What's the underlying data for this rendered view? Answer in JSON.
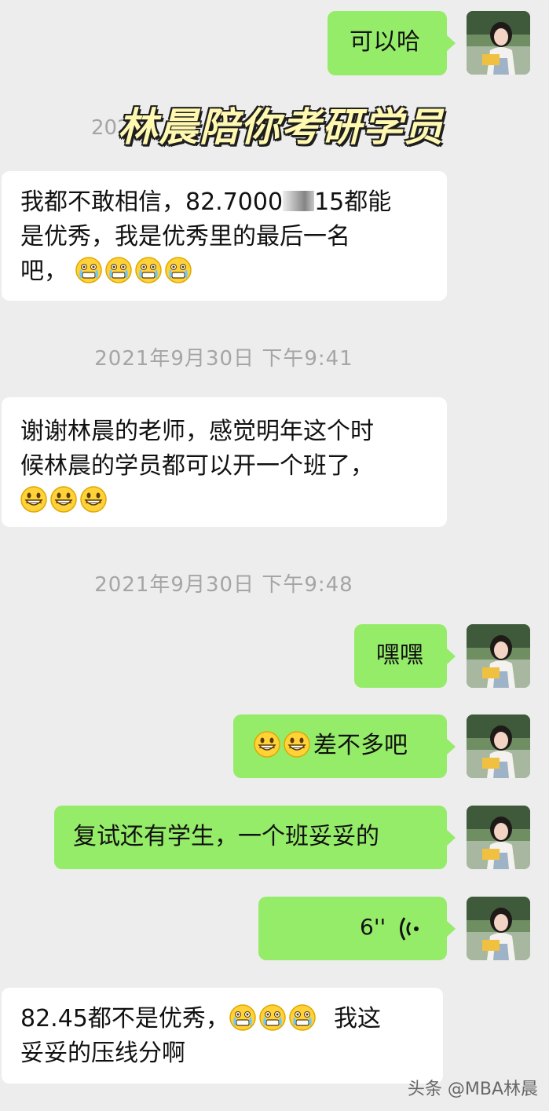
{
  "watermark": {
    "text": "林晨陪你考研学员"
  },
  "partial_timestamp": "2021",
  "messages": [
    {
      "id": "m1",
      "side": "right",
      "text": "可以哈"
    },
    {
      "id": "m2",
      "side": "left",
      "line1": "我都不敢相信，82.7000",
      "line1b": "15都能",
      "line2": "是优秀，我是优秀里的最后一名",
      "line3": "吧，",
      "emoji": "grimace-tears-emoji"
    },
    {
      "id": "ts1",
      "timestamp": "2021年9月30日 下午9:41"
    },
    {
      "id": "m3",
      "side": "left",
      "line1": "谢谢林晨的老师，感觉明年这个时",
      "line2": "候林晨的学员都可以开一个班了，",
      "emoji": "grin-emoji"
    },
    {
      "id": "ts2",
      "timestamp": "2021年9月30日 下午9:48"
    },
    {
      "id": "m4",
      "side": "right",
      "text": "嘿嘿"
    },
    {
      "id": "m5",
      "side": "right",
      "text": "差不多吧",
      "emoji": "grin-emoji"
    },
    {
      "id": "m6",
      "side": "right",
      "text": "复试还有学生，一个班妥妥的"
    },
    {
      "id": "m7",
      "side": "right",
      "voice_duration": "6''"
    },
    {
      "id": "m8",
      "side": "left",
      "line1a": "82.45都不是优秀，",
      "line1b": "我这",
      "line2": "妥妥的压线分啊",
      "emoji": "grimace-tears-emoji"
    }
  ],
  "footer": {
    "text": "头条 @MBA林晨"
  }
}
